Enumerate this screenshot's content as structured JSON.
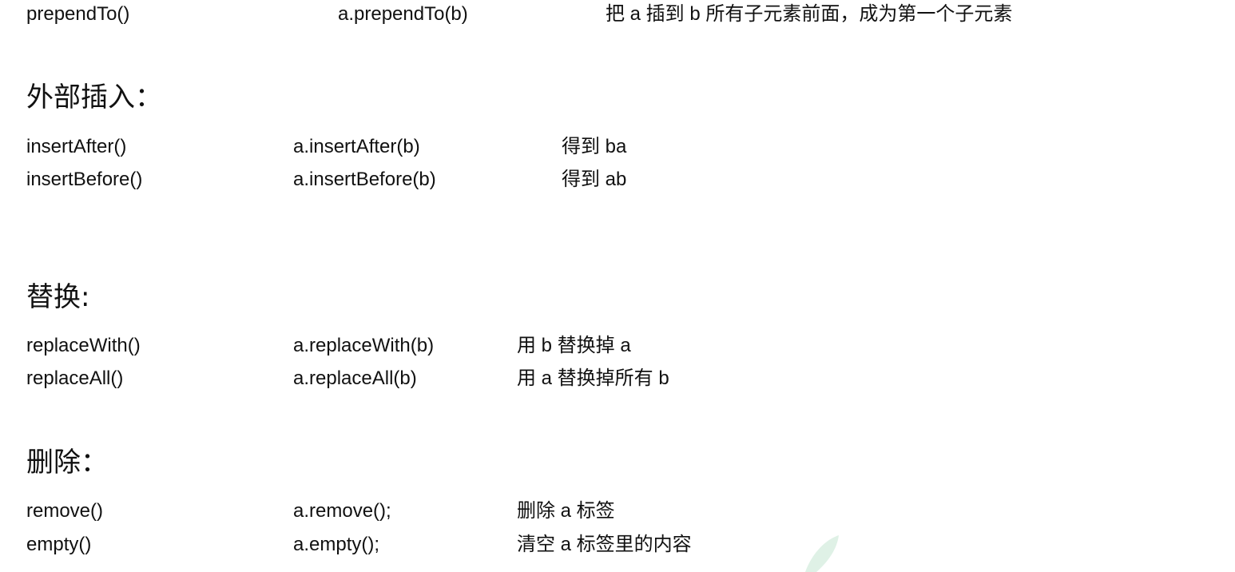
{
  "top_row": {
    "method": "prependTo()",
    "usage": "a.prependTo(b)",
    "desc": "把 a 插到 b 所有子元素前面，成为第一个子元素"
  },
  "sections": {
    "external_insert": {
      "heading": "外部插入：",
      "rows": [
        {
          "method": "insertAfter()",
          "usage": "a.insertAfter(b)",
          "desc": "得到 ba"
        },
        {
          "method": "insertBefore()",
          "usage": "a.insertBefore(b)",
          "desc": "得到 ab"
        }
      ]
    },
    "replace": {
      "heading": "替换:",
      "rows": [
        {
          "method": "replaceWith()",
          "usage": "a.replaceWith(b)",
          "desc": "用 b 替换掉 a"
        },
        {
          "method": "replaceAll()",
          "usage": "a.replaceAll(b)",
          "desc": "用 a 替换掉所有 b"
        }
      ]
    },
    "delete": {
      "heading": "删除：",
      "rows": [
        {
          "method": "remove()",
          "usage": "a.remove();",
          "desc": "删除  a 标签"
        },
        {
          "method": "empty()",
          "usage": "a.empty();",
          "desc": "清空 a 标签里的内容"
        }
      ]
    }
  },
  "colors": {
    "text": "#111111",
    "watermark": "#dff1e6"
  }
}
